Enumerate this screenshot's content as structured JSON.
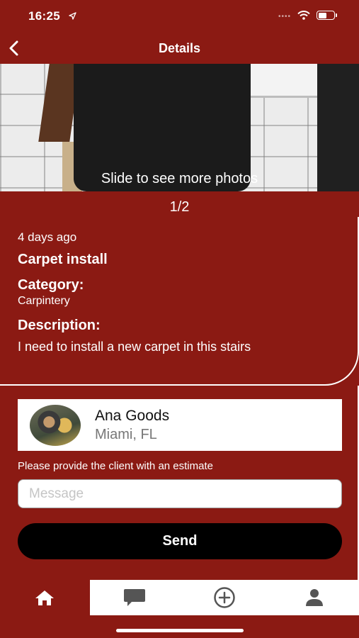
{
  "status_bar": {
    "time": "16:25"
  },
  "nav": {
    "title": "Details"
  },
  "photo": {
    "caption": "Slide to see more photos",
    "page_indicator": "1/2"
  },
  "job": {
    "posted": "4 days ago",
    "title": "Carpet install",
    "category_heading": "Category:",
    "category": "Carpintery",
    "description_heading": "Description:",
    "description": "I need to install a new carpet in this stairs"
  },
  "client": {
    "name": "Ana Goods",
    "location": "Miami, FL"
  },
  "estimate": {
    "label": "Please provide the client with an estimate",
    "placeholder": "Message",
    "send_label": "Send"
  },
  "tabs": [
    {
      "icon": "home-icon",
      "active": true
    },
    {
      "icon": "chat-icon",
      "active": false
    },
    {
      "icon": "add-circle-icon",
      "active": false
    },
    {
      "icon": "profile-icon",
      "active": false
    }
  ],
  "colors": {
    "brand": "#8b1a13",
    "button": "#000000",
    "inactive_icon": "#555555"
  }
}
